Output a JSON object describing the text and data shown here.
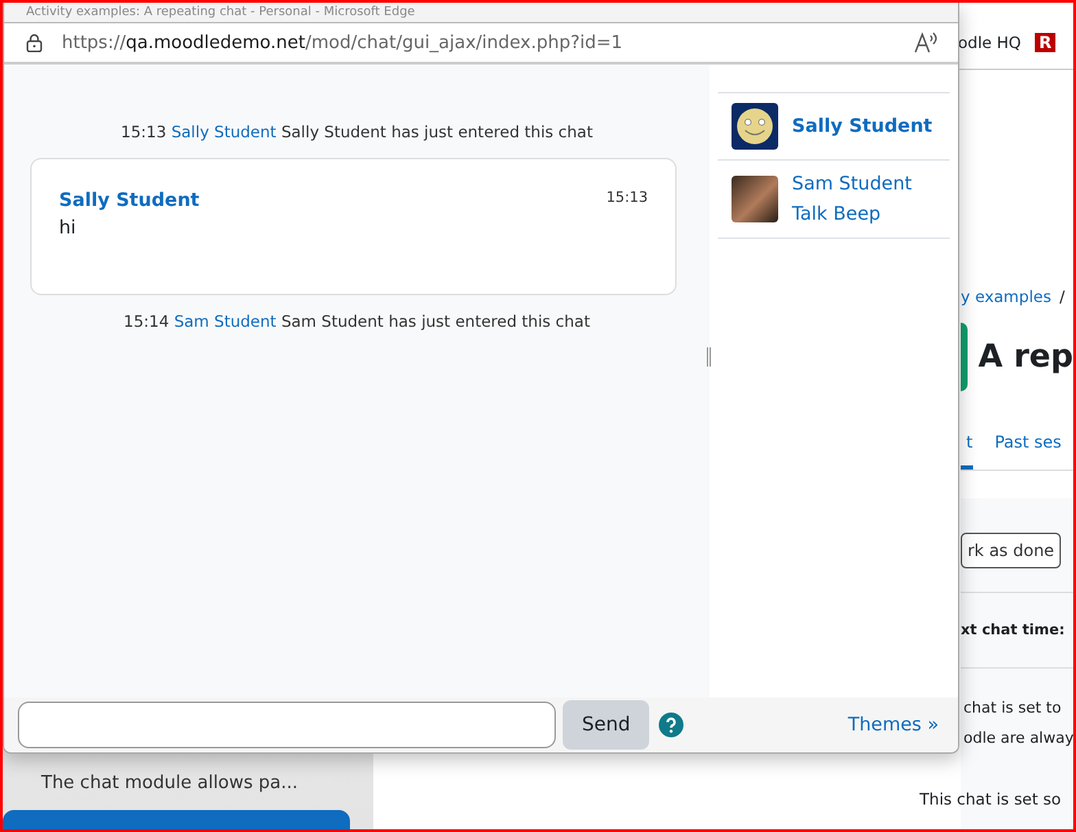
{
  "window": {
    "title": "Activity examples: A repeating chat - Personal - Microsoft Edge"
  },
  "address_bar": {
    "scheme": "https://",
    "host": "qa.moodledemo.net",
    "path": "/mod/chat/gui_ajax/index.php?id=1"
  },
  "messages": [
    {
      "kind": "event",
      "time": "15:13",
      "user": "Sally Student",
      "text": "Sally Student has just entered this chat"
    },
    {
      "kind": "message",
      "time": "15:13",
      "user": "Sally Student",
      "text": "hi"
    },
    {
      "kind": "event",
      "time": "15:14",
      "user": "Sam Student",
      "text": "Sam Student has just entered this chat"
    }
  ],
  "users": [
    {
      "name": "Sally Student",
      "kind": "smiley",
      "selected": true
    },
    {
      "name": "Sam Student",
      "kind": "photo",
      "selected": false,
      "action": "Talk Beep"
    }
  ],
  "composer": {
    "send_label": "Send",
    "themes_link": "Themes »"
  },
  "background_page": {
    "site_name": "odle HQ",
    "logo_letter": "R",
    "breadcrumb": "y examples",
    "breadcrumb_separator": "/",
    "heading": "A rep",
    "tabs": [
      {
        "label": "t",
        "selected": true
      },
      {
        "label": "Past ses",
        "selected": false
      }
    ],
    "button": "rk as done",
    "next_chat_label": "xt chat time:",
    "paragraph_lines": [
      "chat is set to",
      "odle are alway"
    ],
    "note": "This chat is set so",
    "sidebar_text": "The chat module allows pa..."
  }
}
